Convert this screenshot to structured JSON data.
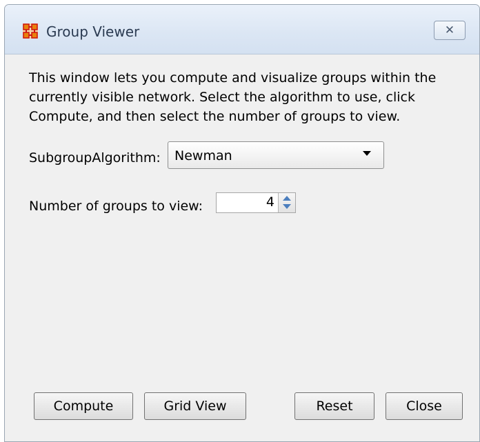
{
  "window": {
    "title": "Group Viewer",
    "close_symbol": "✕",
    "icon": "network-graph-icon"
  },
  "content": {
    "description": "This window lets you compute and visualize groups within the currently visible network. Select the algorithm to use, click Compute, and then select the number of groups to view.",
    "algorithm": {
      "label": "SubgroupAlgorithm:",
      "selected": "Newman"
    },
    "groups": {
      "label": "Number of groups to view:",
      "value": "4"
    }
  },
  "buttons": {
    "compute": "Compute",
    "grid_view": "Grid View",
    "reset": "Reset",
    "close": "Close"
  },
  "colors": {
    "icon_orange": "#e8820c",
    "icon_red": "#cc1111",
    "spinner_arrow": "#4c7fbe"
  }
}
